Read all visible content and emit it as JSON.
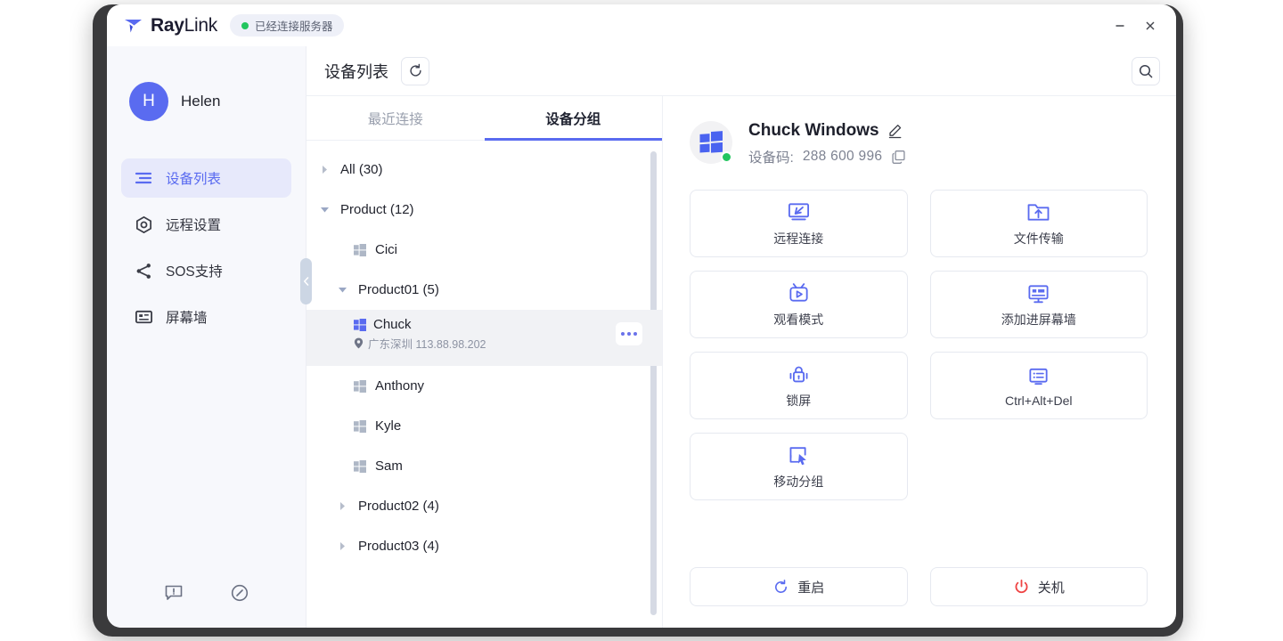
{
  "window": {
    "brand_main": "Ray",
    "brand_sub": "Link",
    "status_text": "已经连接服务器",
    "minimize_label": "–",
    "close_label": "✕",
    "accent_color": "#5a6bf0",
    "online_color": "#22c55e",
    "danger_color": "#ef4444"
  },
  "sidebar": {
    "avatar_initial": "H",
    "user_name": "Helen",
    "items": [
      {
        "label": "设备列表",
        "icon": "list-icon",
        "active": true
      },
      {
        "label": "远程设置",
        "icon": "gear-hex-icon",
        "active": false
      },
      {
        "label": "SOS支持",
        "icon": "share-nodes-icon",
        "active": false
      },
      {
        "label": "屏幕墙",
        "icon": "monitor-icon",
        "active": false
      }
    ],
    "footer": [
      {
        "icon": "feedback-icon"
      },
      {
        "icon": "compass-icon"
      }
    ]
  },
  "topbar": {
    "title": "设备列表",
    "refresh_icon": "refresh-icon",
    "search_icon": "search-icon"
  },
  "tree_pane": {
    "tabs": [
      {
        "label": "最近连接",
        "active": false
      },
      {
        "label": "设备分组",
        "active": true
      }
    ],
    "rows": [
      {
        "type": "group",
        "label": "All (30)",
        "expanded": false,
        "indent": 0
      },
      {
        "type": "group",
        "label": "Product (12)",
        "expanded": true,
        "indent": 0
      },
      {
        "type": "device",
        "label": "Cici",
        "indent": 1,
        "selected": false
      },
      {
        "type": "group",
        "label": "Product01 (5)",
        "expanded": true,
        "indent": 1
      },
      {
        "type": "device",
        "label": "Chuck",
        "indent": 2,
        "selected": true,
        "location": "广东深圳 113.88.98.202"
      },
      {
        "type": "device",
        "label": "Anthony",
        "indent": 2,
        "selected": false
      },
      {
        "type": "device",
        "label": "Kyle",
        "indent": 2,
        "selected": false
      },
      {
        "type": "device",
        "label": "Sam",
        "indent": 2,
        "selected": false
      },
      {
        "type": "group",
        "label": "Product02 (4)",
        "expanded": false,
        "indent": 1
      },
      {
        "type": "group",
        "label": "Product03 (4)",
        "expanded": false,
        "indent": 1
      }
    ]
  },
  "detail": {
    "device_name": "Chuck Windows",
    "code_label": "设备码:",
    "code_value": "288 600 996",
    "edit_icon": "pencil-icon",
    "copy_icon": "copy-icon",
    "platform_icon": "windows-icon",
    "actions": [
      {
        "label": "远程连接",
        "icon": "remote-connect-icon"
      },
      {
        "label": "文件传输",
        "icon": "file-transfer-icon"
      },
      {
        "label": "观看模式",
        "icon": "watch-mode-icon"
      },
      {
        "label": "添加进屏幕墙",
        "icon": "add-to-screen-wall-icon"
      },
      {
        "label": "锁屏",
        "icon": "lock-screen-icon"
      },
      {
        "label": "Ctrl+Alt+Del",
        "icon": "ctrl-alt-del-icon"
      },
      {
        "label": "移动分组",
        "icon": "move-group-icon"
      }
    ],
    "power": [
      {
        "label": "重启",
        "icon": "restart-icon",
        "color": "#5a6bf0"
      },
      {
        "label": "关机",
        "icon": "power-icon",
        "color": "#ef4444"
      }
    ]
  }
}
